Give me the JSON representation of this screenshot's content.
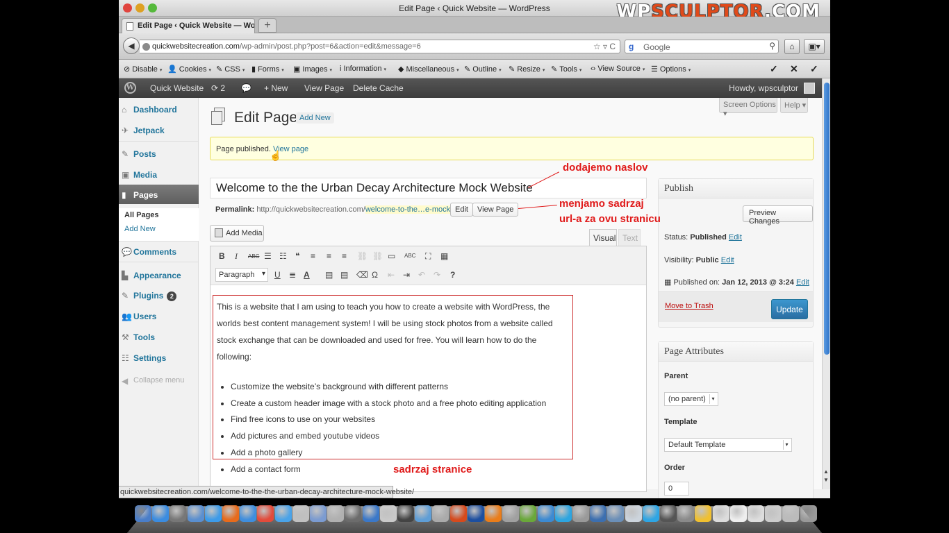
{
  "window": {
    "title": "Edit Page ‹ Quick Website — WordPress",
    "brand_prefix": "WP",
    "brand_accent": "SCULPTOR",
    "brand_suffix": ".COM"
  },
  "tab": {
    "label": "Edit Page ‹ Quick Website — Wo...",
    "new_tab": "+"
  },
  "nav": {
    "url_host": "quickwebsitecreation.com",
    "url_path": "/wp-admin/post.php?post=6&action=edit&message=6",
    "url_tools": "☆ ▿ C",
    "search_placeholder": "Google",
    "search_engine_glyph": "g"
  },
  "devbar": {
    "items": [
      "Disable",
      "Cookies",
      "CSS",
      "Forms",
      "Images",
      "Information",
      "Miscellaneous",
      "Outline",
      "Resize",
      "Tools",
      "View Source",
      "Options"
    ],
    "icons": [
      "⊘",
      "👤",
      "✎",
      "▮",
      "▣",
      "i",
      "◆",
      "✎",
      "✎",
      "✎",
      "‹›",
      "☰"
    ],
    "checks": [
      "✓",
      "✕",
      "✓"
    ]
  },
  "adminbar": {
    "site_name": "Quick Website",
    "updates_count": "2",
    "new_label": "New",
    "view_page": "View Page",
    "delete_cache": "Delete Cache",
    "howdy": "Howdy, wpsculptor"
  },
  "sidebar": {
    "items": [
      {
        "label": "Dashboard",
        "icon": "⌂"
      },
      {
        "label": "Jetpack",
        "icon": "✈"
      },
      {
        "label": "Posts",
        "icon": "✎"
      },
      {
        "label": "Media",
        "icon": "▣"
      },
      {
        "label": "Pages",
        "icon": "▮"
      },
      {
        "label": "Comments",
        "icon": "💬"
      },
      {
        "label": "Appearance",
        "icon": "▙"
      },
      {
        "label": "Plugins",
        "icon": "✎",
        "badge": "2"
      },
      {
        "label": "Users",
        "icon": "👥"
      },
      {
        "label": "Tools",
        "icon": "⚒"
      },
      {
        "label": "Settings",
        "icon": "☷"
      }
    ],
    "submenu": [
      "All Pages",
      "Add New"
    ],
    "collapse": "Collapse menu"
  },
  "screen_meta": {
    "screen_options": "Screen Options ▾",
    "help": "Help ▾"
  },
  "page": {
    "title": "Edit Page",
    "add_new": "Add New",
    "notice_text": "Page published.",
    "notice_link": "View page"
  },
  "post": {
    "title": "Welcome to the the Urban Decay Architecture Mock Website",
    "permalink_label": "Permalink:",
    "permalink_base": "http://quickwebsitecreation.com/",
    "permalink_slug": "welcome-to-the…e-mock-website/",
    "edit_btn": "Edit",
    "view_page_btn": "View Page",
    "add_media": "Add Media",
    "tab_visual": "Visual",
    "tab_text": "Text",
    "format": "Paragraph",
    "body_paragraph": "This is a website that I am using to teach you how to create a website with WordPress, the worlds best content management system!  I will be using stock photos from a website called stock exchange that can be downloaded and used for free.  You will learn how to do the following:",
    "body_list": [
      "Customize the website’s background with different patterns",
      "Create a custom header image with a stock photo and a free photo editing application",
      "Find free icons to use on your websites",
      "Add pictures and embed youtube videos",
      "Add a photo gallery",
      "Add a contact form"
    ]
  },
  "toolbar": {
    "row1": [
      "B",
      "I",
      "ABC",
      "☰",
      "☷",
      "❝",
      "≡",
      "≡",
      "≡",
      "⛓",
      "⛓",
      "▭",
      "ABC",
      "⛶",
      "▦"
    ],
    "row2": [
      "U",
      "≣",
      "A",
      "▤",
      "▤",
      "⌫",
      "Ω",
      "⇤",
      "⇥",
      "↶",
      "↷",
      "?"
    ]
  },
  "publish": {
    "heading": "Publish",
    "preview": "Preview Changes",
    "status_label": "Status:",
    "status_value": "Published",
    "visibility_label": "Visibility:",
    "visibility_value": "Public",
    "published_on_label": "Published on:",
    "published_on_value": "Jan 12, 2013 @ 3:24",
    "edit_link": "Edit",
    "trash": "Move to Trash",
    "update": "Update"
  },
  "page_attributes": {
    "heading": "Page Attributes",
    "parent_label": "Parent",
    "parent_value": "(no parent)",
    "template_label": "Template",
    "template_value": "Default Template",
    "order_label": "Order",
    "order_value": "0"
  },
  "annotations": {
    "title_note": "dodajemo naslov",
    "url_note_1": "menjamo sadrzaj",
    "url_note_2": "url-a za ovu stranicu",
    "content_note": "sadrzaj stranice"
  },
  "statusbar": "quickwebsitecreation.com/welcome-to-the-the-urban-decay-architecture-mock-website/",
  "dock_colors": [
    "#4a7ec9",
    "#3b8ce0",
    "#777777",
    "#5a8fd0",
    "#3d9be9",
    "#e76b1c",
    "#3f8ede",
    "#e34b3b",
    "#4aa3e8",
    "#c0c0c0",
    "#7b9bd1",
    "#b0b0b0",
    "#6c6c6c",
    "#3b78c8",
    "#c9c9c9",
    "#444444",
    "#5f9ed6",
    "#aaaaaa",
    "#d64a1d",
    "#1d4fa0",
    "#ea7d1a",
    "#a0a0a0",
    "#6aa83a",
    "#3c8ad2",
    "#2da5e0",
    "#999999",
    "#3c6fb0",
    "#6b8fb8",
    "#ccd4dc",
    "#2ea5e4",
    "#555555",
    "#8a8a8a",
    "#f0c030",
    "#dcdcdc",
    "#eeeeee",
    "#dddddd",
    "#cccccc",
    "#bbbbbb",
    "#999999"
  ]
}
